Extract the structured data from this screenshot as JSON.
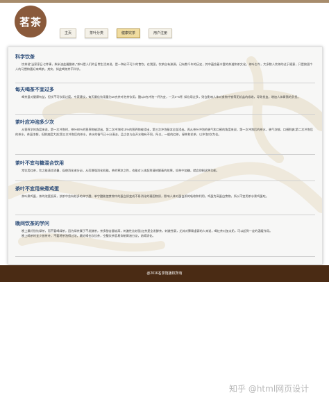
{
  "logo": {
    "text": "茗茶"
  },
  "nav": {
    "items": [
      {
        "label": "主页",
        "active": false
      },
      {
        "label": "茶叶分类",
        "active": false
      },
      {
        "label": "健康饮茶",
        "active": true
      },
      {
        "label": "用户注册",
        "active": false
      }
    ]
  },
  "sections": [
    {
      "title": "科学饮茶",
      "paragraphs": [
        "饮茶说”当家家日七件事，柴米油盐酱醋茶。”茶叶是人们的日常生活来说，是一种必不可少的食饮。在我国，饮茶自有渊源，已有数千年的历史，其中蕴含着丰富的茶道和茶文化。茶叶古今，大多数人饮茶的过于随意，只是按固个人的习惯和喜好来喝茶。其实，如此喝茶并不科学。"
      ]
    },
    {
      "title": "每天喝茶不宜过多",
      "paragraphs": [
        "喝茶虽对健康有益，但饮不可饮用过度。专家建议，每天最佳饮用量为10克茶叶泡茶饮用，酸以3克冲泡一杯为宜，一天3~4杯; 如饮用过多，则会影响人体对食物中铁等无机盐的吸收，导致贫血，增加人体胃肠的负担。"
      ]
    },
    {
      "title": "茶叶应冲泡多少次",
      "paragraphs": [
        "从营养学的角度来说，第一次冲泡时，茶叶80%的营养物被浸出，第二次冲泡时15%的营养物被浸出，第三次冲泡基本全部浸出。再从茶叶冲泡的香气和口感的角度来说，第一次冲泡后的茶水，香气浓郁，口感鲜爽;第二次冲泡后的茶水，茶虽浓郁，但鲜爽度大减;第三次冲泡后的茶水，茶水的香气已十分清淡，品之仅与白开水略有不同，所以，一般的红茶，绿茶和花茶，以冲泡3次为佳。"
      ]
    },
    {
      "title": "茶叶不宜与糖混合饮用",
      "paragraphs": [
        "常饮用红茶，饮之能清凉消暑，促使消化液分泌，从而增强消化机能。茶的寒凉之性，也能对人体起到清热解毒的效果。如茶中加糖，就会抑制这种功能。"
      ]
    },
    {
      "title": "茶叶不宜用来煮鸡蛋",
      "paragraphs": [
        "茶叶煮鸡蛋，茶的浓度很高，浓茶中含有较多的单宁酸，单宁酸能使食物中的蛋白质变成不易消化的凝固物质，影响人体对蛋白质的吸收和利用。鸡蛋为高蛋白食物，所以不宜用茶水煮鸡蛋吃。"
      ]
    },
    {
      "title": "晚间饮茶的学问",
      "paragraphs": [
        "晚上最好别饮绿茶，而不要喝绿茶，因为绿茶属于不发酵茶，茶多酚含量较高，刺激性比较强;红茶是全发酵茶，刺激性弱，尤其对脾胃虚弱的人来说，喝红茶对加点奶，可以起到一定的温暖作用。",
        "晚上喝茶时宜少放茶叶，不要将茶泡得过浓，最好喝也饮饮茶，空腹饮茶容易抑制胃液分泌，妨碍消化。"
      ]
    }
  ],
  "footer": {
    "text": "@2016名茶馆版权所有"
  },
  "watermark": {
    "text": "知乎 @html网页设计"
  }
}
